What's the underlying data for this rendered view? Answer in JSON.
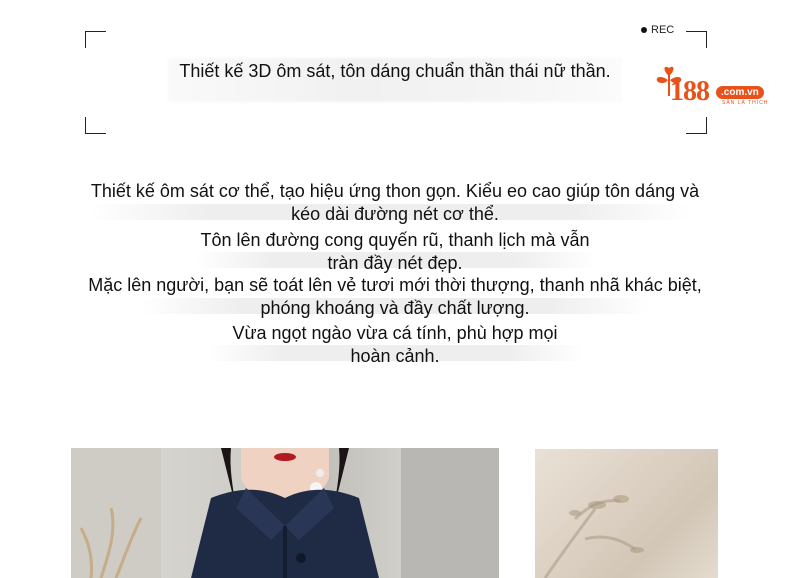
{
  "recorder": {
    "label": "REC"
  },
  "headline": "Thiết kế 3D ôm sát, tôn dáng chuẩn thần thái nữ thần.",
  "logo": {
    "number": "188",
    "domain": ".com.vn",
    "tagline": "SĂN LÀ THÍCH",
    "brand_color": "#e8521a"
  },
  "paragraphs": [
    {
      "line1": "Thiết kế ôm sát cơ thể, tạo hiệu ứng thon gọn. Kiểu eo cao giúp tôn dáng và",
      "line2": "kéo dài đường nét cơ thể."
    },
    {
      "line1": "Tôn lên đường cong quyến rũ, thanh lịch mà vẫn",
      "line2": "tràn đầy nét đẹp."
    },
    {
      "line1": "Mặc lên người, bạn sẽ toát lên vẻ tươi mới thời thượng, thanh nhã khác biệt,",
      "line2": "phóng khoáng và đầy chất lượng."
    },
    {
      "line1": "Vừa ngọt ngào vừa cá tính, phù hợp mọi",
      "line2": "hoàn cảnh."
    }
  ],
  "images": {
    "left": "model-photo-navy-dress",
    "right": "decor-photo-dried-flowers"
  }
}
